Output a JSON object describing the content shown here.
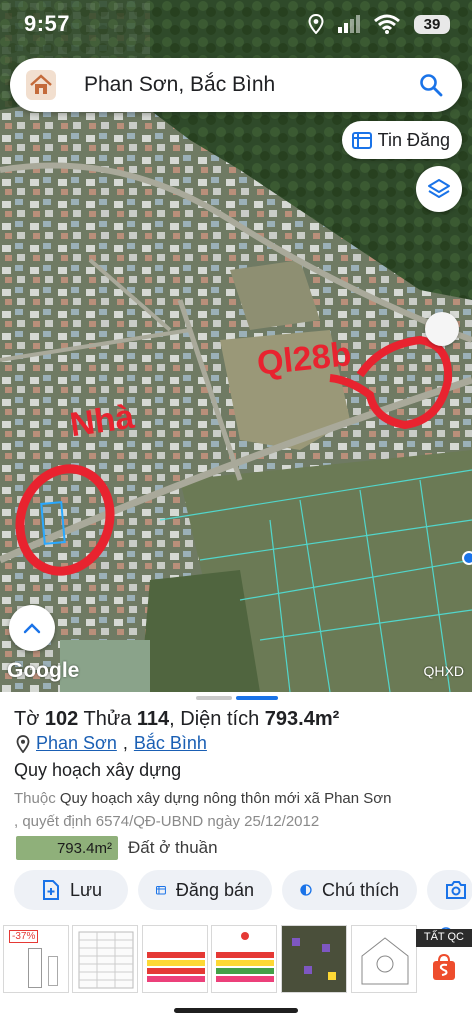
{
  "status": {
    "time": "9:57",
    "battery": "39"
  },
  "search": {
    "query": "Phan Sơn, Bắc Bình"
  },
  "map": {
    "tin_dang_label": "Tin Đăng",
    "annotation_house": "Nhà",
    "annotation_road": "Ql28b",
    "google_label": "Google",
    "overlay_label": "QHXD"
  },
  "parcel": {
    "to_label": "Tờ",
    "to_value": "102",
    "thua_label": "Thửa",
    "thua_value": "114",
    "area_label": "Diện tích",
    "area_value": "793.4m²",
    "commune": "Phan Sơn",
    "district": "Bắc Bình",
    "plan_title": "Quy hoạch xây dựng",
    "plan_prefix": "Thuộc",
    "plan_name": "Quy hoạch xây dựng nông thôn mới xã Phan Sơn",
    "plan_decision": ", quyết định 6574/QĐ-UBND ngày 25/12/2012",
    "land_area": "793.4m²",
    "land_type": "Đất ở thuần"
  },
  "actions": {
    "save": "Lưu",
    "post_sale": "Đăng bán",
    "legend": "Chú thích"
  },
  "ads": {
    "tag": "TẤT QC",
    "discount": "-37%"
  },
  "colors": {
    "accent": "#1a73e8",
    "annotation_red": "#e8232f",
    "parcel_green": "#8fb07a",
    "action_bg": "#eef1f6"
  }
}
